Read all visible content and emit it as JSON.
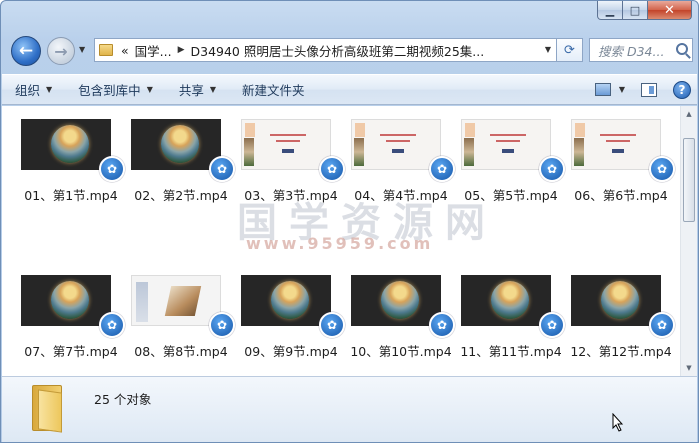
{
  "window": {
    "caption": {
      "minimize": "▁",
      "maximize": "□",
      "close": "✕"
    }
  },
  "nav": {
    "back_icon": "←",
    "forward_icon": "→",
    "breadcrumb": {
      "overflow": "«",
      "part1": "国学...",
      "sep": "▶",
      "part2": "D34940 照明居士头像分析高级班第二期视频25集..."
    },
    "refresh_icon": "⟳",
    "search_placeholder": "搜索 D34..."
  },
  "toolbar": {
    "organize": "组织",
    "include": "包含到库中",
    "share": "共享",
    "new_folder": "新建文件夹",
    "help": "?"
  },
  "watermark": {
    "text": "国学资源网",
    "url": "www.95959.com"
  },
  "files": [
    {
      "label": "01、第1节.mp4",
      "thumb": "video"
    },
    {
      "label": "02、第2节.mp4",
      "thumb": "video"
    },
    {
      "label": "03、第3节.mp4",
      "thumb": "slide"
    },
    {
      "label": "04、第4节.mp4",
      "thumb": "slide"
    },
    {
      "label": "05、第5节.mp4",
      "thumb": "slide"
    },
    {
      "label": "06、第6节.mp4",
      "thumb": "slide"
    },
    {
      "label": "07、第7节.mp4",
      "thumb": "video"
    },
    {
      "label": "08、第8节.mp4",
      "thumb": "room"
    },
    {
      "label": "09、第9节.mp4",
      "thumb": "video"
    },
    {
      "label": "10、第10节.mp4",
      "thumb": "video"
    },
    {
      "label": "11、第11节.mp4",
      "thumb": "video"
    },
    {
      "label": "12、第12节.mp4",
      "thumb": "video"
    }
  ],
  "details": {
    "count": "25 个对象"
  }
}
